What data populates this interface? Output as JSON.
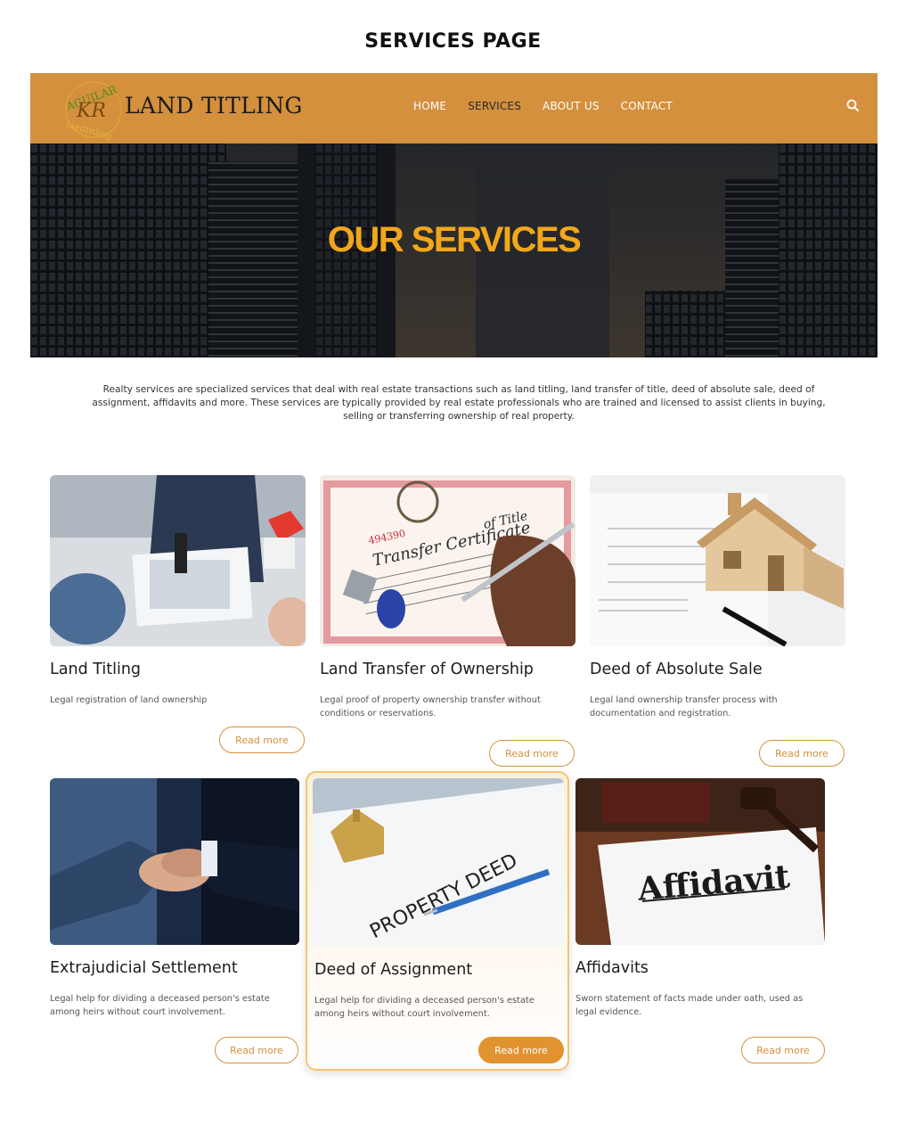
{
  "page_caption": "SERVICES PAGE",
  "header": {
    "logo_text": "AGUILAR KR landtitling",
    "brand": "LAND TITLING",
    "nav": [
      {
        "label": "HOME"
      },
      {
        "label": "SERVICES"
      },
      {
        "label": "ABOUT US"
      },
      {
        "label": "CONTACT"
      }
    ],
    "search_icon": "search-icon",
    "bg_color": "#d4903d"
  },
  "hero": {
    "title": "OUR SERVICES",
    "title_color": "#f2a71b"
  },
  "intro": "Realty services are specialized services that deal with real estate transactions such as land titling, land transfer of title, deed of absolute sale, deed of assignment, affidavits and more. These services are typically provided by real estate professionals who are trained and licensed to assist clients in buying, selling or transferring ownership of real property.",
  "services": [
    {
      "title": "Land Titling",
      "description": "Legal  registration of land ownership",
      "button": "Read more"
    },
    {
      "title": "Land Transfer of Ownership",
      "description": "Legal proof of property ownership transfer without conditions or reservations.",
      "button": "Read more",
      "image_text": {
        "number": "494390",
        "line1": "Transfer Certificate",
        "line2": "of Title"
      }
    },
    {
      "title": "Deed of Absolute Sale",
      "description": "Legal land ownership transfer process with documentation and registration.",
      "button": "Read more"
    },
    {
      "title": "Extrajudicial Settlement",
      "description": "Legal help for dividing a deceased person's estate among heirs without court involvement.",
      "button": "Read more"
    },
    {
      "title": "Deed of Assignment",
      "description": "Legal help for dividing a deceased person's estate among heirs without court involvement.",
      "button": "Read more",
      "image_text": "PROPERTY DEED"
    },
    {
      "title": "Affidavits",
      "description": "Sworn statement of facts made under oath, used as legal evidence.",
      "button": "Read more",
      "image_text": "Affidavit"
    }
  ],
  "accent_color": "#d4903d"
}
